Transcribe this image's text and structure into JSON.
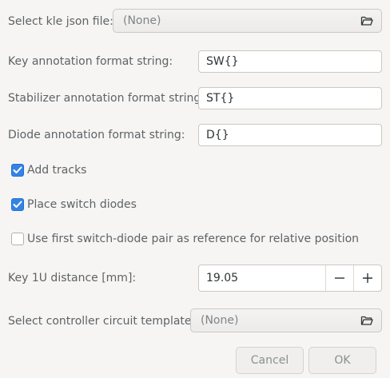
{
  "kle": {
    "label": "Select kle json file:",
    "value": "(None)",
    "icon": "folder-open-icon"
  },
  "key_format": {
    "label": "Key annotation format string:",
    "value": "SW{}"
  },
  "stab_format": {
    "label": "Stabilizer annotation format string:",
    "value": "ST{}"
  },
  "diode_format": {
    "label": "Diode annotation format string:",
    "value": "D{}"
  },
  "add_tracks": {
    "label": "Add tracks",
    "checked": true
  },
  "place_diodes": {
    "label": "Place switch diodes",
    "checked": true
  },
  "use_first_pair": {
    "label": "Use first switch-diode pair as reference for relative position",
    "checked": false
  },
  "key_distance": {
    "label": "Key 1U distance [mm]:",
    "value": "19.05",
    "decrement_icon": "minus-icon",
    "increment_icon": "plus-icon"
  },
  "controller_template": {
    "label": "Select controller circuit template:",
    "value": "(None)",
    "icon": "folder-open-icon"
  },
  "buttons": {
    "cancel": "Cancel",
    "ok": "OK"
  },
  "colors": {
    "background": "#f6f5f4",
    "accent": "#3584e4",
    "label_text": "#5e6366"
  }
}
